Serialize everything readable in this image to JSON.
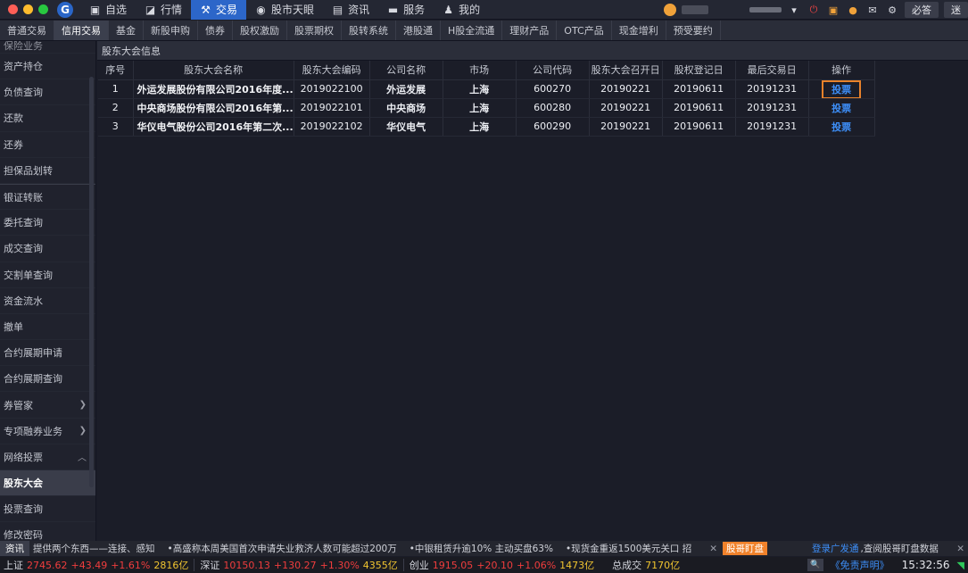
{
  "topbar": {
    "nav": [
      {
        "label": "自选",
        "icon": "square-icon"
      },
      {
        "label": "行情",
        "icon": "chart-icon"
      },
      {
        "label": "交易",
        "icon": "gavel-icon",
        "active": true
      },
      {
        "label": "股市天眼",
        "icon": "eye-icon"
      },
      {
        "label": "资讯",
        "icon": "newspaper-icon"
      },
      {
        "label": "服务",
        "icon": "briefcase-icon"
      },
      {
        "label": "我的",
        "icon": "user-icon"
      }
    ],
    "btn_bida": "必答",
    "btn_mi": "迷"
  },
  "tabs": [
    {
      "label": "普通交易"
    },
    {
      "label": "信用交易",
      "active": true
    },
    {
      "label": "基金"
    },
    {
      "label": "新股申购"
    },
    {
      "label": "债券"
    },
    {
      "label": "股权激励"
    },
    {
      "label": "股票期权"
    },
    {
      "label": "股转系统"
    },
    {
      "label": "港股通"
    },
    {
      "label": "H股全流通"
    },
    {
      "label": "理财产品"
    },
    {
      "label": "OTC产品"
    },
    {
      "label": "现金增利"
    },
    {
      "label": "预受要约"
    }
  ],
  "sidebar": {
    "partial_top": "保险业务",
    "items": [
      {
        "label": "资产持仓"
      },
      {
        "label": "负债查询"
      },
      {
        "label": "还款"
      },
      {
        "label": "还券"
      },
      {
        "label": "担保品划转"
      },
      {
        "label": "银证转账"
      },
      {
        "label": "委托查询"
      },
      {
        "label": "成交查询"
      },
      {
        "label": "交割单查询"
      },
      {
        "label": "资金流水"
      },
      {
        "label": "撤单"
      },
      {
        "label": "合约展期申请"
      },
      {
        "label": "合约展期查询"
      },
      {
        "label": "券管家"
      },
      {
        "label": "专项融券业务"
      },
      {
        "label": "网络投票"
      },
      {
        "label": "股东大会"
      },
      {
        "label": "投票查询"
      },
      {
        "label": "修改密码"
      }
    ]
  },
  "panel": {
    "title": "股东大会信息",
    "columns": [
      "序号",
      "股东大会名称",
      "股东大会编码",
      "公司名称",
      "市场",
      "公司代码",
      "股东大会召开日",
      "股权登记日",
      "最后交易日",
      "操作"
    ],
    "rows": [
      [
        "1",
        "外运发展股份有限公司2016年度...",
        "2019022100",
        "外运发展",
        "上海",
        "600270",
        "20190221",
        "20190611",
        "20191231",
        "投票"
      ],
      [
        "2",
        "中央商场股份有限公司2016年第...",
        "2019022101",
        "中央商场",
        "上海",
        "600280",
        "20190221",
        "20190611",
        "20191231",
        "投票"
      ],
      [
        "3",
        "华仪电气股份公司2016年第二次...",
        "2019022102",
        "华仪电气",
        "上海",
        "600290",
        "20190221",
        "20190611",
        "20191231",
        "投票"
      ]
    ]
  },
  "ticker": {
    "label": "资讯",
    "items": [
      "提供两个东西——连接、感知",
      "•高盛称本周美国首次申请失业救济人数可能超过200万",
      "•中银租赁升逾10% 主动买盘63%",
      "•现货金重返1500美元关口 招"
    ],
    "tag": "股哥盯盘",
    "login_link": "登录广发通",
    "login_text": ",查阅股哥盯盘数据"
  },
  "status": {
    "indices": [
      {
        "name": "上证",
        "value": "2745.62",
        "change": "+43.49",
        "pct": "+1.61%",
        "amount": "2816亿"
      },
      {
        "name": "深证",
        "value": "10150.13",
        "change": "+130.27",
        "pct": "+1.30%",
        "amount": "4355亿"
      },
      {
        "name": "创业",
        "value": "1915.05",
        "change": "+20.10",
        "pct": "+1.06%",
        "amount": "1473亿"
      }
    ],
    "total_label": "总成交",
    "total_value": "7170亿",
    "disclaimer": "《免责声明》",
    "time": "15:32:56"
  }
}
